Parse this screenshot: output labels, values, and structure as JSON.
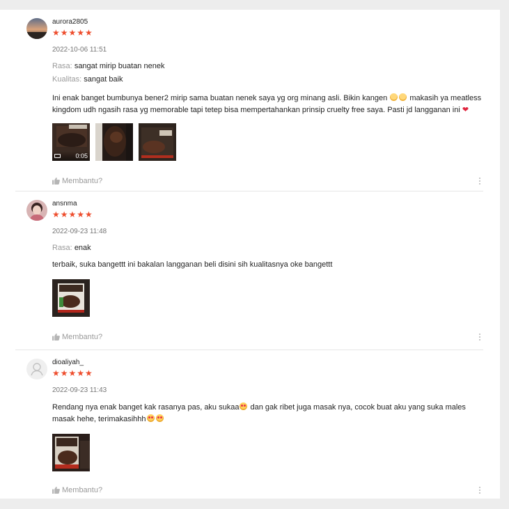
{
  "reviews": [
    {
      "username": "aurora2805",
      "rating_stars": "★★★★★",
      "rating": 5,
      "time": "2022-10-06 11:51",
      "attributes": [
        {
          "key": "Rasa:",
          "value": "sangat mirip buatan nenek"
        },
        {
          "key": "Kualitas:",
          "value": "sangat baik"
        }
      ],
      "text_part1": "Ini enak banget bumbunya bener2 mirip sama buatan nenek saya yg org minang asli. Bikin kangen ",
      "text_part2": " makasih ya meatless kingdom udh ngasih rasa yg memorable tapi tetep bisa mempertahankan prinsip cruelty free saya. Pasti jd langganan ini ",
      "video_duration": "0:05",
      "helpful_label": "Membantu?"
    },
    {
      "username": "ansnma",
      "rating_stars": "★★★★★",
      "rating": 5,
      "time": "2022-09-23 11:48",
      "attributes": [
        {
          "key": "Rasa:",
          "value": "enak"
        }
      ],
      "text": "terbaik, suka bangettt ini bakalan langganan beli disini sih kualitasnya oke bangettt",
      "helpful_label": "Membantu?"
    },
    {
      "username": "dioaliyah_",
      "rating_stars": "★★★★★",
      "rating": 5,
      "time": "2022-09-23 11:43",
      "text_part1": "Rendang nya enak banget kak rasanya pas, aku sukaa",
      "text_part2": " dan gak ribet juga masak nya, cocok buat aku yang suka males masak hehe, terimakasihhh",
      "helpful_label": "Membantu?"
    }
  ],
  "colors": {
    "star": "#ee4d2d",
    "muted": "#9a9a9a",
    "divider": "#e6e6e6"
  },
  "icons": [
    "thumb-up-icon",
    "more-vertical-icon",
    "video-camera-icon",
    "heart-emoji",
    "cry-emoji",
    "heart-eyes-emoji",
    "default-avatar-icon"
  ]
}
